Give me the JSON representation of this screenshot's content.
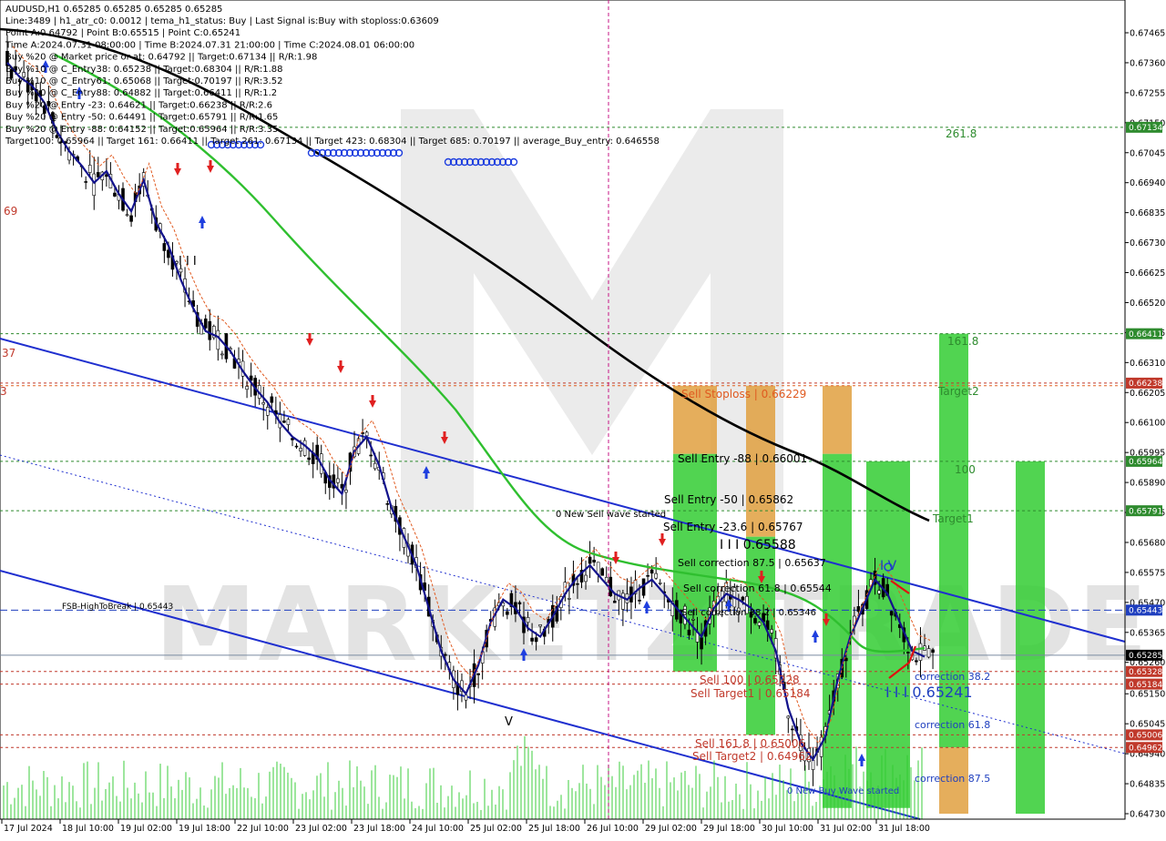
{
  "window": {
    "symbol_line": "AUDUSD,H1  0.65285 0.65285 0.65285 0.65285"
  },
  "info_lines": [
    "Line:3489 | h1_atr_c0: 0.0012 | tema_h1_status: Buy | Last Signal is:Buy with stoploss:0.63609",
    "Point A:0.64792 | Point B:0.65515 | Point C:0.65241",
    "Time A:2024.07.31 08:00:00 | Time B:2024.07.31 21:00:00 | Time C:2024.08.01 06:00:00",
    "Buy %20 @ Market price or at: 0.64792 || Target:0.67134 || R/R:1.98",
    "Buy %10 @ C_Entry38: 0.65238 || Target:0.68304 || R/R:1.88",
    "Buy %10 @ C_Entry61: 0.65068 || Target:0.70197 || R/R:3.52",
    "Buy %10 @ C_Entry88: 0.64882 || Target:0.66411 || R/R:1.2",
    "Buy %20 @ Entry -23: 0.64621 || Target:0.66238 || R/R:2.6",
    "Buy %20 @ Entry -50: 0.64491 || Target:0.65791 || R/R:1.65",
    "Buy %20 @ Entry -88: 0.64152 || Target:0.65964 || R/R:3.35",
    "Target100: 0.65964 || Target 161: 0.66411 || Target 261: 0.67134 || Target 423: 0.68304 || Target 685: 0.70197 || average_Buy_entry: 0.646558"
  ],
  "price_axis": {
    "ticks": [
      "0.67465",
      "0.67360",
      "0.67255",
      "0.67150",
      "0.67045",
      "0.66940",
      "0.66835",
      "0.66730",
      "0.66625",
      "0.66520",
      "0.66415",
      "0.66310",
      "0.66205",
      "0.66100",
      "0.65995",
      "0.65890",
      "0.65785",
      "0.65680",
      "0.65575",
      "0.65470",
      "0.65365",
      "0.65260",
      "0.65150",
      "0.65045",
      "0.64940",
      "0.64835",
      "0.64730"
    ],
    "tags": [
      {
        "text": "0.67134",
        "bg": "#2e8b2e",
        "fg": "#ffffff",
        "price": 0.67134
      },
      {
        "text": "0.66411",
        "bg": "#2e8b2e",
        "fg": "#ffffff",
        "price": 0.66411
      },
      {
        "text": "0.66238",
        "bg": "#c0392b",
        "fg": "#ffffff",
        "price": 0.66238
      },
      {
        "text": "0.65964",
        "bg": "#2e8b2e",
        "fg": "#ffffff",
        "price": 0.65964
      },
      {
        "text": "0.65791",
        "bg": "#2e8b2e",
        "fg": "#ffffff",
        "price": 0.65791
      },
      {
        "text": "0.65443",
        "bg": "#1f3fbf",
        "fg": "#ffffff",
        "price": 0.65443
      },
      {
        "text": "0.65285",
        "bg": "#000000",
        "fg": "#ffffff",
        "price": 0.65285
      },
      {
        "text": "0.65328",
        "bg": "#c0392b",
        "fg": "#ffffff",
        "price": 0.65228
      },
      {
        "text": "0.65184",
        "bg": "#c0392b",
        "fg": "#ffffff",
        "price": 0.65184
      },
      {
        "text": "0.65006",
        "bg": "#c0392b",
        "fg": "#ffffff",
        "price": 0.65006
      },
      {
        "text": "0.64962",
        "bg": "#c0392b",
        "fg": "#ffffff",
        "price": 0.64962
      }
    ]
  },
  "time_axis": [
    "17 Jul 2024",
    "18 Jul 10:00",
    "19 Jul 02:00",
    "19 Jul 18:00",
    "22 Jul 10:00",
    "23 Jul 02:00",
    "23 Jul 18:00",
    "24 Jul 10:00",
    "25 Jul 02:00",
    "25 Jul 18:00",
    "26 Jul 10:00",
    "29 Jul 02:00",
    "29 Jul 18:00",
    "30 Jul 10:00",
    "31 Jul 02:00",
    "31 Jul 18:00"
  ],
  "levels": {
    "fsb": "FSB-HighToBreak | 0.65443",
    "sell_stoploss": "Sell Stoploss | 0.66229",
    "sell_entry_88": "Sell Entry -88 | 0.66001",
    "sell_entry_50": "Sell Entry -50 | 0.65862",
    "sell_entry_23": "Sell Entry -23.6 | 0.65767",
    "mid_label": "I I I 0.65588",
    "sell_corr_875": "Sell correction 87.5 | 0.65637",
    "sell_corr_618": "Sell correction 61.8 | 0.65544",
    "sell_corr_382": "Sell correction 38.2 | 0.65346",
    "sell_100": "Sell 100 | 0.65228",
    "sell_target1": "Sell Target1 | 0.65184",
    "sell_1618": "Sell 161.8 | 0.65006",
    "sell_target2": "Sell Target2 | 0.64962",
    "new_sell_wave": "0 New Sell wave started",
    "new_buy_wave": "0 New Buy Wave started",
    "buy_point_c": "I I I 0.65241",
    "corr_382": "correction 38.2",
    "corr_618": "correction 61.8",
    "corr_875": "correction 87.5",
    "t_2618": "261.8",
    "t_1618": "161.8",
    "t_target2": "Target2",
    "t_100": "100",
    "t_target1": "Target1",
    "iv": "I V",
    "v": "V",
    "iii": "I I I",
    "left_69": "69",
    "left_37": "37",
    "left_3": "3"
  },
  "watermark": "MARKETZITRADE",
  "colors": {
    "ma_black": "#000000",
    "ma_green": "#2fbf2f",
    "ma_navy": "#12128c",
    "channel": "#1f2fcf",
    "sell_box_orange": "#e0a040",
    "buy_box_green": "#33cc33",
    "red_level": "#c0392b",
    "green_level": "#2e8b2e"
  },
  "chart_data": {
    "type": "line",
    "title": "AUDUSD,H1",
    "ylim": [
      0.6468,
      0.6752
    ],
    "series": [
      {
        "name": "tema",
        "values": []
      }
    ],
    "price_path": [
      0.6736,
      0.6731,
      0.6728,
      0.6722,
      0.6712,
      0.6705,
      0.67,
      0.6694,
      0.6698,
      0.669,
      0.6684,
      0.6695,
      0.668,
      0.6672,
      0.666,
      0.665,
      0.6642,
      0.664,
      0.6635,
      0.6628,
      0.6622,
      0.6617,
      0.661,
      0.6605,
      0.6602,
      0.6598,
      0.659,
      0.6585,
      0.66,
      0.6605,
      0.6595,
      0.658,
      0.657,
      0.656,
      0.6545,
      0.653,
      0.652,
      0.6515,
      0.6525,
      0.654,
      0.6548,
      0.6545,
      0.6538,
      0.6535,
      0.6542,
      0.655,
      0.6556,
      0.656,
      0.6555,
      0.655,
      0.6548,
      0.6552,
      0.6555,
      0.655,
      0.6545,
      0.654,
      0.6535,
      0.6545,
      0.655,
      0.6548,
      0.6545,
      0.654,
      0.653,
      0.651,
      0.6498,
      0.6492,
      0.65,
      0.652,
      0.6535,
      0.6545,
      0.6555,
      0.655,
      0.654,
      0.653,
      0.6528
    ]
  }
}
